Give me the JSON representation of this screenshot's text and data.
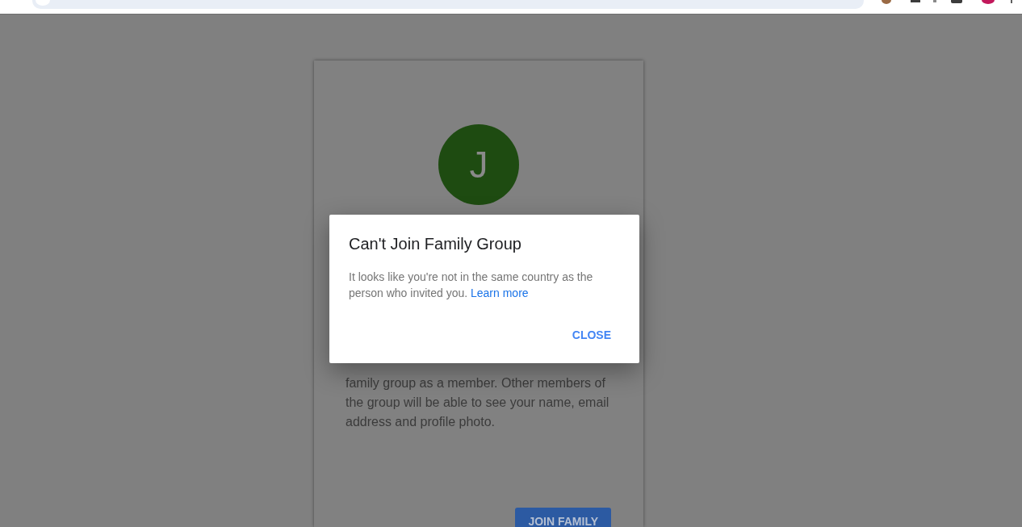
{
  "card": {
    "avatar": {
      "initial": "J"
    },
    "description": "family group as a member. Other members of the group will be able to see your name, email address and profile photo.",
    "button": "JOIN FAMILY"
  },
  "dialog": {
    "title": "Can't Join Family Group",
    "message": "It looks like you're not in the same country as the person who invited you.",
    "link": "Learn more",
    "button": "CLOSE"
  }
}
